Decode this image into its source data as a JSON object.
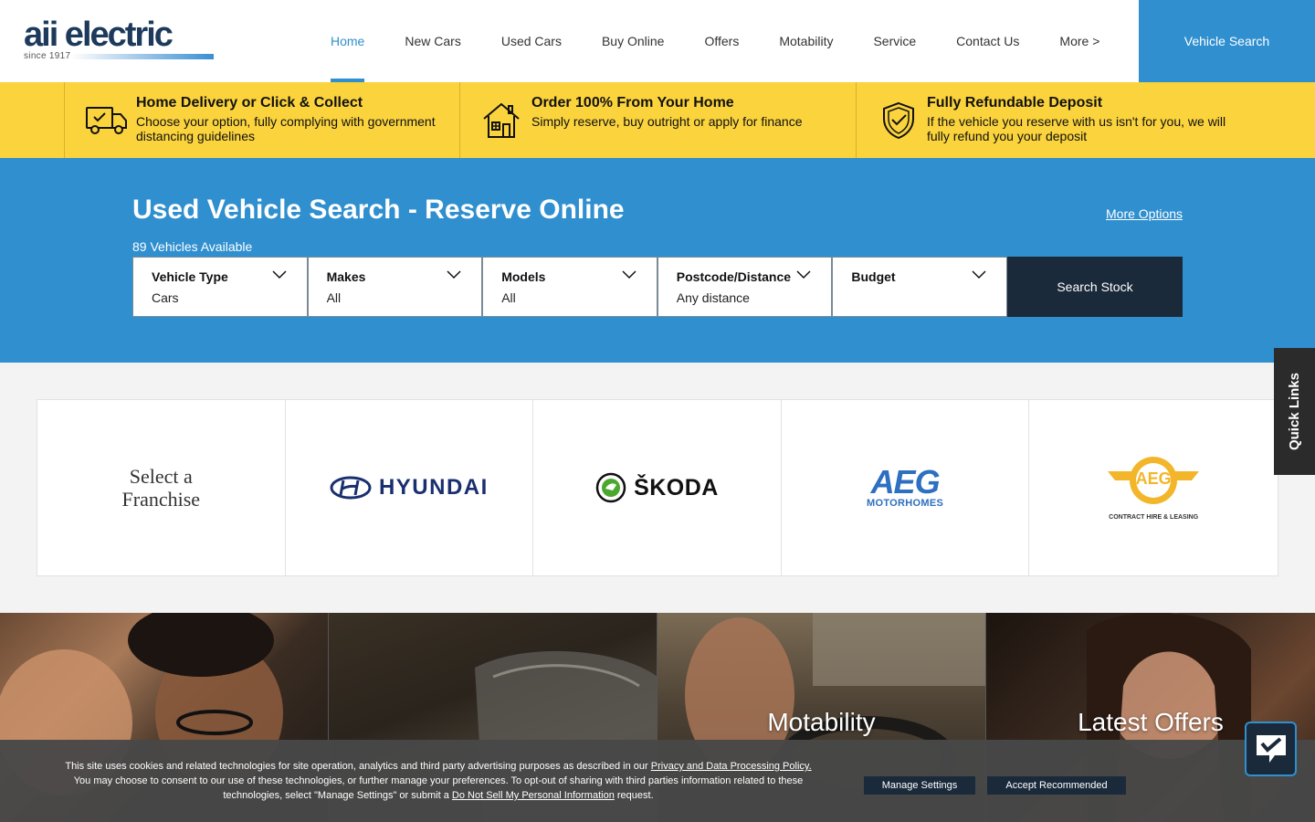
{
  "header": {
    "logo_text": "aii electric",
    "logo_since": "since 1917",
    "nav": [
      {
        "label": "Home",
        "active": true
      },
      {
        "label": "New Cars"
      },
      {
        "label": "Used Cars"
      },
      {
        "label": "Buy Online"
      },
      {
        "label": "Offers"
      },
      {
        "label": "Motability"
      },
      {
        "label": "Service"
      },
      {
        "label": "Contact Us"
      },
      {
        "label": "More >"
      }
    ],
    "vehicle_search_label": "Vehicle Search"
  },
  "usps": [
    {
      "icon": "delivery-van-icon",
      "title": "Home Delivery or Click & Collect",
      "text": "Choose your option, fully complying with government distancing guidelines"
    },
    {
      "icon": "house-icon",
      "title": "Order 100% From Your Home",
      "text": "Simply reserve, buy outright or apply for finance"
    },
    {
      "icon": "shield-check-icon",
      "title": "Fully Refundable Deposit",
      "text": "If the vehicle you reserve with us isn't for you, we will fully refund you your deposit"
    }
  ],
  "search": {
    "title": "Used Vehicle Search - Reserve Online",
    "more_options": "More Options",
    "vehicles_available": "89 Vehicles Available",
    "filters": [
      {
        "label": "Vehicle Type",
        "value": "Cars"
      },
      {
        "label": "Makes",
        "value": "All"
      },
      {
        "label": "Models",
        "value": "All"
      },
      {
        "label": "Postcode/Distance",
        "value": "Any distance"
      },
      {
        "label": "Budget",
        "value": ""
      }
    ],
    "submit_label": "Search Stock"
  },
  "franchises": {
    "heading_line1": "Select a",
    "heading_line2": "Franchise",
    "brands": [
      {
        "name": "HYUNDAI"
      },
      {
        "name": "ŠKODA"
      },
      {
        "name": "AEG",
        "sub": "MOTORHOMES"
      },
      {
        "name": "AEG",
        "sub": "CONTRACT HIRE & LEASING"
      }
    ]
  },
  "tiles": [
    {
      "label": ""
    },
    {
      "label": ""
    },
    {
      "label": "Motability"
    },
    {
      "label": "Latest Offers"
    }
  ],
  "quick_links_label": "Quick Links",
  "cookie": {
    "text_1": "This site uses cookies and related technologies for site operation, analytics and third party advertising purposes as described in our ",
    "link_1": "Privacy and Data Processing Policy.",
    "text_2": " You may choose to consent to our use of these technologies, or further manage your preferences. To opt-out of sharing with third parties information related to these technologies, select \"Manage Settings\" or submit a ",
    "link_2": "Do Not Sell My Personal Information",
    "text_3": " request.",
    "manage_label": "Manage Settings",
    "accept_label": "Accept Recommended"
  },
  "colors": {
    "brand_blue": "#2f8fcf",
    "usp_yellow": "#fad33d",
    "navy": "#1b2a3a"
  }
}
